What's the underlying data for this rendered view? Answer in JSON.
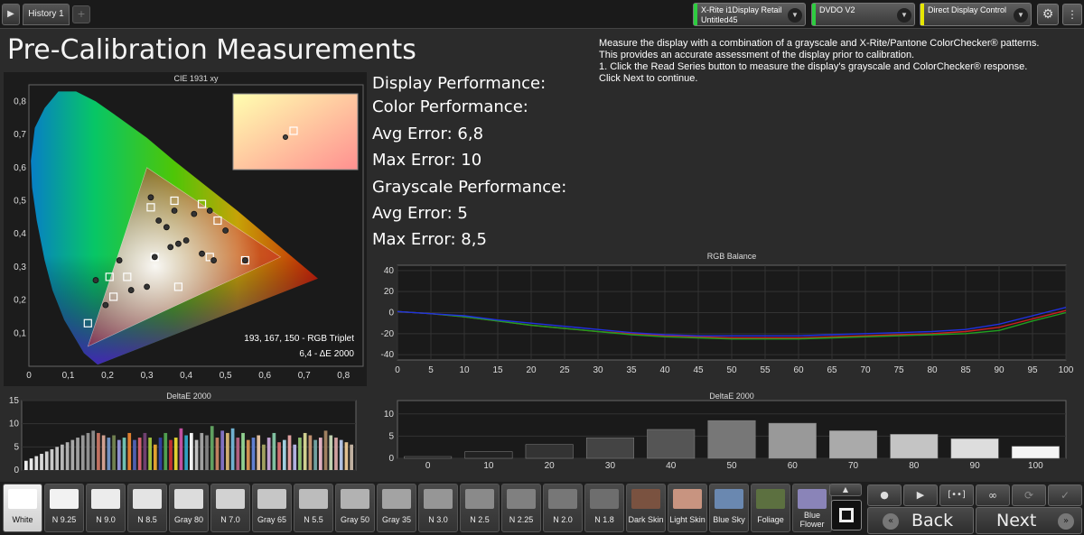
{
  "topbar": {
    "history_tab": "History 1",
    "add_tab": "+",
    "meter": {
      "line1": "X-Rite i1Display Retail",
      "line2": "Untitled45",
      "color": "#2ecc40"
    },
    "source": {
      "line1": "DVDO V2",
      "color": "#2ecc40"
    },
    "display": {
      "line1": "Direct Display Control",
      "color": "#e6e600"
    }
  },
  "title": "Pre-Calibration Measurements",
  "instructions": {
    "line1": "Measure the display with a combination of a grayscale and X-Rite/Pantone ColorChecker® patterns.",
    "line2": "This provides an accurate assessment of the display prior to calibration.",
    "line3": "1. Click the Read Series button to measure the display's grayscale and ColorChecker® response.",
    "line4": "Click Next to continue."
  },
  "performance": {
    "display": "Display Performance:",
    "color": "Color Performance:",
    "color_avg": "Avg Error: 6,8",
    "color_max": "Max Error: 10",
    "grayscale": "Grayscale Performance:",
    "gray_avg": "Avg Error: 5",
    "gray_max": "Max Error: 8,5"
  },
  "chart_data": [
    {
      "type": "scatter",
      "title": "CIE 1931 xy",
      "xlim": [
        0,
        0.85
      ],
      "ylim": [
        0,
        0.85
      ],
      "x_ticks": [
        "0",
        "0,1",
        "0,2",
        "0,3",
        "0,4",
        "0,5",
        "0,6",
        "0,7",
        "0,8"
      ],
      "y_ticks": [
        "0,1",
        "0,2",
        "0,3",
        "0,4",
        "0,5",
        "0,6",
        "0,7",
        "0,8"
      ],
      "target_gamut": [
        [
          0.64,
          0.33
        ],
        [
          0.3,
          0.6
        ],
        [
          0.15,
          0.06
        ]
      ],
      "measured": [
        [
          0.195,
          0.185
        ],
        [
          0.17,
          0.26
        ],
        [
          0.23,
          0.32
        ],
        [
          0.26,
          0.23
        ],
        [
          0.3,
          0.24
        ],
        [
          0.32,
          0.33
        ],
        [
          0.33,
          0.44
        ],
        [
          0.31,
          0.51
        ],
        [
          0.35,
          0.42
        ],
        [
          0.37,
          0.47
        ],
        [
          0.42,
          0.46
        ],
        [
          0.46,
          0.47
        ],
        [
          0.36,
          0.36
        ],
        [
          0.38,
          0.37
        ],
        [
          0.4,
          0.38
        ],
        [
          0.44,
          0.34
        ],
        [
          0.47,
          0.32
        ],
        [
          0.55,
          0.32
        ],
        [
          0.5,
          0.41
        ]
      ],
      "targets": [
        [
          0.15,
          0.13
        ],
        [
          0.205,
          0.27
        ],
        [
          0.215,
          0.21
        ],
        [
          0.25,
          0.27
        ],
        [
          0.32,
          0.33
        ],
        [
          0.31,
          0.48
        ],
        [
          0.37,
          0.5
        ],
        [
          0.44,
          0.49
        ],
        [
          0.48,
          0.44
        ],
        [
          0.38,
          0.24
        ],
        [
          0.46,
          0.33
        ],
        [
          0.55,
          0.32
        ]
      ],
      "annotations": [
        "193, 167, 150 - RGB Triplet",
        "6,4 - ΔE 2000"
      ]
    },
    {
      "type": "line",
      "title": "RGB Balance",
      "x": [
        0,
        5,
        10,
        15,
        20,
        25,
        30,
        35,
        40,
        45,
        50,
        55,
        60,
        65,
        70,
        75,
        80,
        85,
        90,
        95,
        100
      ],
      "xlim": [
        0,
        100
      ],
      "ylim": [
        -45,
        45
      ],
      "y_ticks": [
        40,
        20,
        0,
        -20,
        -40
      ],
      "series": [
        {
          "color": "#cc2020",
          "values": [
            1,
            -1,
            -4,
            -8,
            -12,
            -15,
            -18,
            -20,
            -22,
            -23,
            -24,
            -24,
            -24,
            -23,
            -22,
            -21,
            -20,
            -18,
            -14,
            -6,
            2
          ]
        },
        {
          "color": "#20a020",
          "values": [
            1,
            -1,
            -4,
            -8,
            -12,
            -15,
            -18,
            -21,
            -23,
            -24,
            -25,
            -25,
            -25,
            -24,
            -23,
            -22,
            -21,
            -20,
            -17,
            -8,
            0
          ]
        },
        {
          "color": "#2030e0",
          "values": [
            1,
            -1,
            -3,
            -7,
            -10,
            -13,
            -16,
            -19,
            -21,
            -22,
            -22,
            -22,
            -22,
            -21,
            -20,
            -19,
            -18,
            -16,
            -11,
            -3,
            5
          ]
        }
      ]
    },
    {
      "type": "bar",
      "title": "DeltaE 2000",
      "ylim": [
        0,
        15
      ],
      "y_ticks": [
        15,
        10,
        5,
        0
      ],
      "values": [
        2,
        2.5,
        3,
        3.5,
        4,
        4.5,
        5,
        5.5,
        6,
        6.5,
        7,
        7.5,
        8,
        8.5,
        8,
        7.5,
        7,
        7.5,
        6.5,
        7,
        8,
        6.5,
        7,
        8,
        7,
        5.5,
        7,
        8,
        6.5,
        7,
        9,
        7.5,
        8,
        6.5,
        8,
        7.5,
        9.5,
        7,
        8.5,
        8,
        9,
        7,
        8,
        6.5,
        7,
        7.5,
        5.5,
        7,
        8,
        6,
        6.5,
        7.5,
        5.5,
        7,
        8,
        7.5,
        6.5,
        7,
        8.5,
        7.5,
        7,
        6.5,
        6,
        5.5
      ],
      "colors": [
        "#eeeeee",
        "#e8e8e8",
        "#e0e0e0",
        "#d8d8d8",
        "#d0d0d0",
        "#c8c8c8",
        "#c0c0c0",
        "#b8b8b8",
        "#b0b0b0",
        "#a8a8a8",
        "#a0a0a0",
        "#989898",
        "#909090",
        "#888888",
        "#c07060",
        "#d0a090",
        "#7090c0",
        "#708050",
        "#9090d0",
        "#70c0b0",
        "#e08030",
        "#5060b0",
        "#d06070",
        "#704070",
        "#a0c040",
        "#e0a030",
        "#3040a0",
        "#50a050",
        "#c03030",
        "#e0d030",
        "#c050a0",
        "#30a0c0",
        "#f0f0f0",
        "#c0c0c0",
        "#a0a0a0",
        "#808080",
        "#60a060",
        "#c08060",
        "#8070c0",
        "#d0b070",
        "#70b0d0",
        "#b06080",
        "#90d090",
        "#d09050",
        "#6080d0",
        "#e0c0a0",
        "#a0a060",
        "#c0a0d0",
        "#80c0a0",
        "#d07070",
        "#a0d0e0",
        "#e0a0a0",
        "#b0b0e0",
        "#90c070",
        "#d0d090",
        "#c09070",
        "#70a0a0",
        "#e0b0c0",
        "#a08060",
        "#c0d0b0",
        "#d0a0a0",
        "#b0c0e0",
        "#e0c090",
        "#c0b0a0"
      ]
    },
    {
      "type": "bar",
      "title": "DeltaE 2000",
      "categories": [
        "0",
        "10",
        "20",
        "30",
        "40",
        "50",
        "60",
        "70",
        "80",
        "90",
        "100"
      ],
      "values": [
        0.4,
        1.5,
        3.1,
        4.6,
        6.5,
        8.5,
        7.9,
        6.2,
        5.4,
        4.4,
        2.7
      ],
      "colors": [
        "#1a1a1a",
        "#222222",
        "#333333",
        "#444444",
        "#555555",
        "#777777",
        "#999999",
        "#aaaaaa",
        "#c4c4c4",
        "#dddddd",
        "#f4f4f4"
      ],
      "ylim": [
        0,
        13
      ],
      "y_ticks": [
        10,
        5,
        0
      ]
    }
  ],
  "swatches": [
    {
      "label": "White",
      "color": "#ffffff",
      "white": true
    },
    {
      "label": "N 9.25",
      "color": "#f2f2f2"
    },
    {
      "label": "N 9.0",
      "color": "#ececec"
    },
    {
      "label": "N 8.5",
      "color": "#e4e4e4"
    },
    {
      "label": "Gray 80",
      "color": "#dcdcdc"
    },
    {
      "label": "N 7.0",
      "color": "#d2d2d2"
    },
    {
      "label": "Gray 65",
      "color": "#c6c6c6"
    },
    {
      "label": "N 5.5",
      "color": "#bcbcbc"
    },
    {
      "label": "Gray 50",
      "color": "#b2b2b2"
    },
    {
      "label": "Gray 35",
      "color": "#a3a3a3"
    },
    {
      "label": "N 3.0",
      "color": "#969696"
    },
    {
      "label": "N 2.5",
      "color": "#8a8a8a"
    },
    {
      "label": "N 2.25",
      "color": "#808080"
    },
    {
      "label": "N 2.0",
      "color": "#777777"
    },
    {
      "label": "N 1.8",
      "color": "#6e6e6e"
    },
    {
      "label": "Dark Skin",
      "color": "#7a5240"
    },
    {
      "label": "Light Skin",
      "color": "#c89480"
    },
    {
      "label": "Blue Sky",
      "color": "#6a88b0"
    },
    {
      "label": "Foliage",
      "color": "#5c7040"
    },
    {
      "label": "Blue Flower",
      "color": "#8a84b8"
    }
  ],
  "nav": {
    "back": "Back",
    "next": "Next"
  }
}
